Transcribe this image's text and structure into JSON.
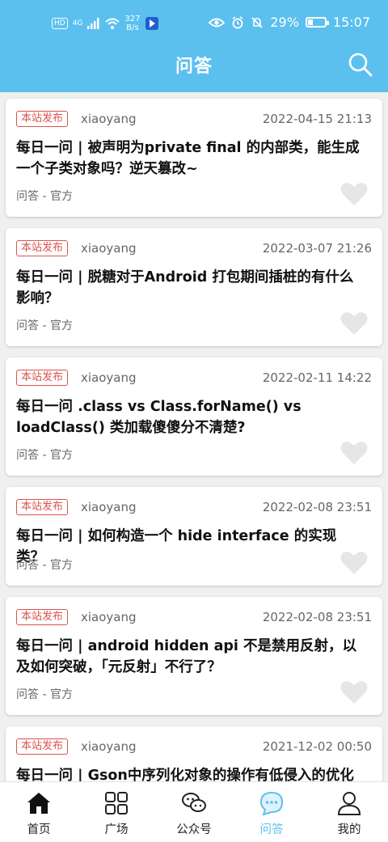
{
  "status_bar": {
    "hd": "HD",
    "signal": "4G",
    "net_speed_value": "327",
    "net_speed_unit": "B/s",
    "battery": "29%",
    "time": "15:07"
  },
  "header": {
    "title": "问答"
  },
  "posts": [
    {
      "tag": "本站发布",
      "author": "xiaoyang",
      "date": "2022-04-15 21:13",
      "title": "每日一问 | 被声明为private final 的内部类，能生成一个子类对象吗？逆天篡改~",
      "chapter": "问答 - 官方"
    },
    {
      "tag": "本站发布",
      "author": "xiaoyang",
      "date": "2022-03-07 21:26",
      "title": "每日一问 | 脱糖对于Android 打包期间插桩的有什么影响？",
      "chapter": "问答 - 官方"
    },
    {
      "tag": "本站发布",
      "author": "xiaoyang",
      "date": "2022-02-11 14:22",
      "title": "每日一问 .class vs Class.forName() vs loadClass() 类加载傻傻分不清楚?",
      "chapter": "问答 - 官方"
    },
    {
      "tag": "本站发布",
      "author": "xiaoyang",
      "date": "2022-02-08 23:51",
      "title": "每日一问 | 如何构造一个 hide interface 的实现类？",
      "chapter": "问答 - 官方"
    },
    {
      "tag": "本站发布",
      "author": "xiaoyang",
      "date": "2022-02-08 23:51",
      "title": "每日一问 | android hidden api 不是禁用反射，以及如何突破，「元反射」不行了？",
      "chapter": "问答 - 官方"
    },
    {
      "tag": "本站发布",
      "author": "xiaoyang",
      "date": "2021-12-02 00:50",
      "title": "每日一问 | Gson中序列化对象的操作有低侵入的优化",
      "chapter": ""
    }
  ],
  "bottom_nav": [
    {
      "label": "首页",
      "icon": "home-icon"
    },
    {
      "label": "广场",
      "icon": "grid-icon"
    },
    {
      "label": "公众号",
      "icon": "wechat-icon"
    },
    {
      "label": "问答",
      "icon": "chat-bubble-icon",
      "active": true
    },
    {
      "label": "我的",
      "icon": "user-icon"
    }
  ],
  "colors": {
    "accent": "#5cc0ef",
    "tag": "#d9534f",
    "heart": "#e6e6e6"
  }
}
